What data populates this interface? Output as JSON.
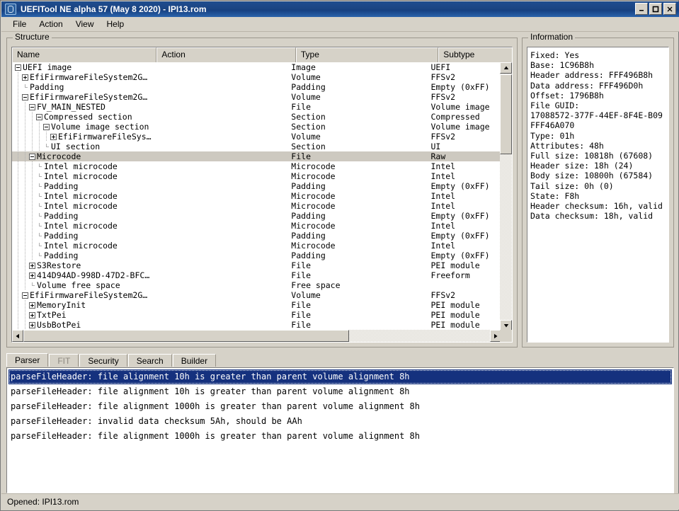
{
  "window": {
    "title": "UEFITool NE alpha 57 (May  8 2020) - IPI13.rom",
    "icon": "app-icon",
    "minimize_label": "_",
    "maximize_label": "□",
    "close_label": "✕"
  },
  "menu": {
    "items": [
      {
        "label": "File"
      },
      {
        "label": "Action"
      },
      {
        "label": "View"
      },
      {
        "label": "Help"
      }
    ]
  },
  "structure": {
    "group_label": "Structure",
    "columns": [
      "Name",
      "Action",
      "Type",
      "Subtype"
    ],
    "rows": [
      {
        "name": "UEFI image",
        "indent": 0,
        "toggle": "minus",
        "action": "",
        "type": "Image",
        "subtype": "UEFI",
        "selected": false
      },
      {
        "name": "EfiFirmwareFileSystem2G…",
        "indent": 1,
        "toggle": "plus",
        "action": "",
        "type": "Volume",
        "subtype": "FFSv2",
        "selected": false
      },
      {
        "name": "Padding",
        "indent": 1,
        "toggle": "leaf",
        "action": "",
        "type": "Padding",
        "subtype": "Empty (0xFF)",
        "selected": false
      },
      {
        "name": "EfiFirmwareFileSystem2G…",
        "indent": 1,
        "toggle": "minus",
        "action": "",
        "type": "Volume",
        "subtype": "FFSv2",
        "selected": false
      },
      {
        "name": "FV_MAIN_NESTED",
        "indent": 2,
        "toggle": "minus",
        "action": "",
        "type": "File",
        "subtype": "Volume image",
        "selected": false
      },
      {
        "name": "Compressed section",
        "indent": 3,
        "toggle": "minus",
        "action": "",
        "type": "Section",
        "subtype": "Compressed",
        "selected": false
      },
      {
        "name": "Volume image section",
        "indent": 4,
        "toggle": "minus",
        "action": "",
        "type": "Section",
        "subtype": "Volume image",
        "selected": false
      },
      {
        "name": "EfiFirmwareFileSys…",
        "indent": 5,
        "toggle": "plus",
        "action": "",
        "type": "Volume",
        "subtype": "FFSv2",
        "selected": false
      },
      {
        "name": "UI section",
        "indent": 4,
        "toggle": "leaf",
        "action": "",
        "type": "Section",
        "subtype": "UI",
        "selected": false
      },
      {
        "name": "Microcode",
        "indent": 2,
        "toggle": "minus",
        "action": "",
        "type": "File",
        "subtype": "Raw",
        "selected": true
      },
      {
        "name": "Intel microcode",
        "indent": 3,
        "toggle": "leaf",
        "action": "",
        "type": "Microcode",
        "subtype": "Intel",
        "selected": false
      },
      {
        "name": "Intel microcode",
        "indent": 3,
        "toggle": "leaf",
        "action": "",
        "type": "Microcode",
        "subtype": "Intel",
        "selected": false
      },
      {
        "name": "Padding",
        "indent": 3,
        "toggle": "leaf",
        "action": "",
        "type": "Padding",
        "subtype": "Empty (0xFF)",
        "selected": false
      },
      {
        "name": "Intel microcode",
        "indent": 3,
        "toggle": "leaf",
        "action": "",
        "type": "Microcode",
        "subtype": "Intel",
        "selected": false
      },
      {
        "name": "Intel microcode",
        "indent": 3,
        "toggle": "leaf",
        "action": "",
        "type": "Microcode",
        "subtype": "Intel",
        "selected": false
      },
      {
        "name": "Padding",
        "indent": 3,
        "toggle": "leaf",
        "action": "",
        "type": "Padding",
        "subtype": "Empty (0xFF)",
        "selected": false
      },
      {
        "name": "Intel microcode",
        "indent": 3,
        "toggle": "leaf",
        "action": "",
        "type": "Microcode",
        "subtype": "Intel",
        "selected": false
      },
      {
        "name": "Padding",
        "indent": 3,
        "toggle": "leaf",
        "action": "",
        "type": "Padding",
        "subtype": "Empty (0xFF)",
        "selected": false
      },
      {
        "name": "Intel microcode",
        "indent": 3,
        "toggle": "leaf",
        "action": "",
        "type": "Microcode",
        "subtype": "Intel",
        "selected": false
      },
      {
        "name": "Padding",
        "indent": 3,
        "toggle": "leaf",
        "action": "",
        "type": "Padding",
        "subtype": "Empty (0xFF)",
        "selected": false
      },
      {
        "name": "S3Restore",
        "indent": 2,
        "toggle": "plus",
        "action": "",
        "type": "File",
        "subtype": "PEI module",
        "selected": false
      },
      {
        "name": "414D94AD-998D-47D2-BFC…",
        "indent": 2,
        "toggle": "plus",
        "action": "",
        "type": "File",
        "subtype": "Freeform",
        "selected": false
      },
      {
        "name": "Volume free space",
        "indent": 2,
        "toggle": "leaf",
        "action": "",
        "type": "Free space",
        "subtype": "",
        "selected": false
      },
      {
        "name": "EfiFirmwareFileSystem2G…",
        "indent": 1,
        "toggle": "minus",
        "action": "",
        "type": "Volume",
        "subtype": "FFSv2",
        "selected": false
      },
      {
        "name": "MemoryInit",
        "indent": 2,
        "toggle": "plus",
        "action": "",
        "type": "File",
        "subtype": "PEI module",
        "selected": false
      },
      {
        "name": "TxtPei",
        "indent": 2,
        "toggle": "plus",
        "action": "",
        "type": "File",
        "subtype": "PEI module",
        "selected": false
      },
      {
        "name": "UsbBotPei",
        "indent": 2,
        "toggle": "plus",
        "action": "",
        "type": "File",
        "subtype": "PEI module",
        "selected": false
      }
    ]
  },
  "information": {
    "group_label": "Information",
    "text": "Fixed: Yes\nBase: 1C96B8h\nHeader address: FFF496B8h\nData address: FFF496D0h\nOffset: 1796B8h\nFile GUID:\n17088572-377F-44EF-8F4E-B09FFF46A070\nType: 01h\nAttributes: 48h\nFull size: 10818h (67608)\nHeader size: 18h (24)\nBody size: 10800h (67584)\nTail size: 0h (0)\nState: F8h\nHeader checksum: 16h, valid\nData checksum: 18h, valid"
  },
  "tabs": {
    "items": [
      {
        "label": "Parser",
        "active": true,
        "disabled": false
      },
      {
        "label": "FIT",
        "active": false,
        "disabled": true
      },
      {
        "label": "Security",
        "active": false,
        "disabled": false
      },
      {
        "label": "Search",
        "active": false,
        "disabled": false
      },
      {
        "label": "Builder",
        "active": false,
        "disabled": false
      }
    ]
  },
  "parser": {
    "lines": [
      {
        "text": "parseFileHeader: file alignment 10h is greater than parent volume alignment 8h",
        "selected": true
      },
      {
        "text": "parseFileHeader: file alignment 10h is greater than parent volume alignment 8h",
        "selected": false
      },
      {
        "text": "parseFileHeader: file alignment 1000h is greater than parent volume alignment 8h",
        "selected": false
      },
      {
        "text": "parseFileHeader: invalid data checksum 5Ah, should be AAh",
        "selected": false
      },
      {
        "text": "parseFileHeader: file alignment 1000h is greater than parent volume alignment 8h",
        "selected": false
      }
    ]
  },
  "statusbar": {
    "text": "Opened: IPI13.rom"
  },
  "colors": {
    "title_start": "#1f4d8f",
    "title_end": "#2a63ab",
    "window_bg": "#d6d2c8",
    "selection_bg": "#15317e",
    "row_selection_bg": "#cdc9c0"
  }
}
